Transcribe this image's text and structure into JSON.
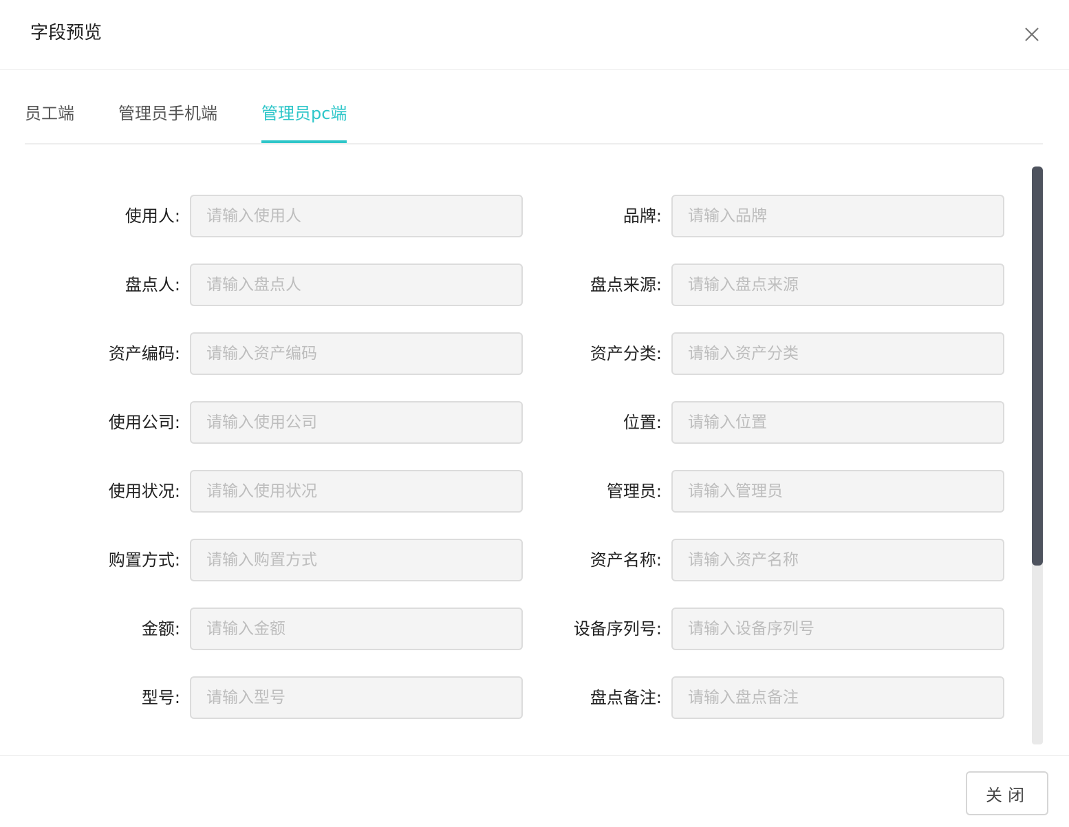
{
  "dialog": {
    "title": "字段预览",
    "close_icon": "close-icon"
  },
  "tabs": [
    {
      "label": "员工端",
      "active": false
    },
    {
      "label": "管理员手机端",
      "active": false
    },
    {
      "label": "管理员pc端",
      "active": true
    }
  ],
  "accent_color": "#2ec6c9",
  "fields": [
    {
      "left": {
        "label": "使用人:",
        "placeholder": "请输入使用人"
      },
      "right": {
        "label": "品牌:",
        "placeholder": "请输入品牌"
      }
    },
    {
      "left": {
        "label": "盘点人:",
        "placeholder": "请输入盘点人"
      },
      "right": {
        "label": "盘点来源:",
        "placeholder": "请输入盘点来源"
      }
    },
    {
      "left": {
        "label": "资产编码:",
        "placeholder": "请输入资产编码"
      },
      "right": {
        "label": "资产分类:",
        "placeholder": "请输入资产分类"
      }
    },
    {
      "left": {
        "label": "使用公司:",
        "placeholder": "请输入使用公司"
      },
      "right": {
        "label": "位置:",
        "placeholder": "请输入位置"
      }
    },
    {
      "left": {
        "label": "使用状况:",
        "placeholder": "请输入使用状况"
      },
      "right": {
        "label": "管理员:",
        "placeholder": "请输入管理员"
      }
    },
    {
      "left": {
        "label": "购置方式:",
        "placeholder": "请输入购置方式"
      },
      "right": {
        "label": "资产名称:",
        "placeholder": "请输入资产名称"
      }
    },
    {
      "left": {
        "label": "金额:",
        "placeholder": "请输入金额"
      },
      "right": {
        "label": "设备序列号:",
        "placeholder": "请输入设备序列号"
      }
    },
    {
      "left": {
        "label": "型号:",
        "placeholder": "请输入型号"
      },
      "right": {
        "label": "盘点备注:",
        "placeholder": "请输入盘点备注"
      }
    }
  ],
  "footer": {
    "close_label": "关闭"
  }
}
